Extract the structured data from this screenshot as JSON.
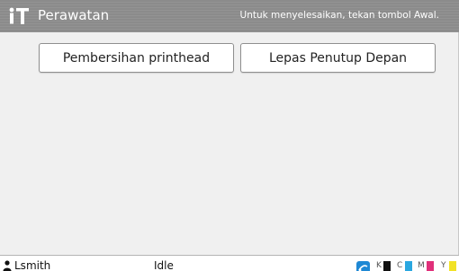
{
  "header": {
    "title": "Perawatan",
    "hint": "Untuk menyelesaikan, tekan tombol Awal.",
    "icon": "maintenance-tools-icon"
  },
  "main": {
    "buttons": [
      {
        "label": "Pembersihan printhead"
      },
      {
        "label": "Lepas Penutup Depan"
      }
    ]
  },
  "status": {
    "user": "Lsmith",
    "state": "Idle",
    "network_icon": "network-icon",
    "inks": [
      {
        "label": "K",
        "color": "#111111"
      },
      {
        "label": "C",
        "color": "#2aa7e0"
      },
      {
        "label": "M",
        "color": "#e0307a"
      },
      {
        "label": "Y",
        "color": "#f2e226"
      }
    ]
  },
  "colors": {
    "header_bg": "#8b8b8b",
    "content_bg": "#f0f0f0",
    "button_border": "#8f8f8f"
  }
}
